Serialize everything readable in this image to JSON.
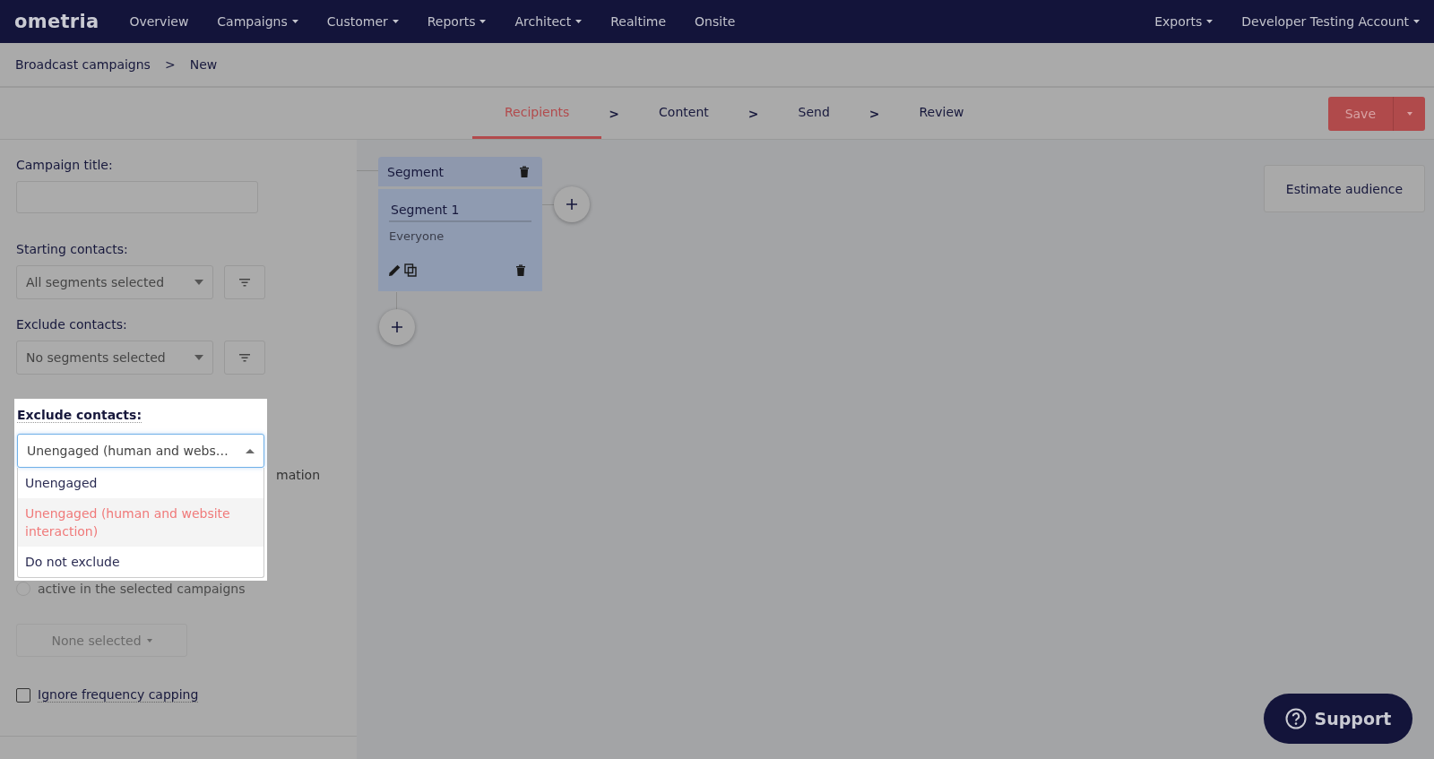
{
  "nav": {
    "logo": "ometria",
    "items": [
      {
        "label": "Overview",
        "dropdown": false
      },
      {
        "label": "Campaigns",
        "dropdown": true
      },
      {
        "label": "Customer",
        "dropdown": true
      },
      {
        "label": "Reports",
        "dropdown": true
      },
      {
        "label": "Architect",
        "dropdown": true
      },
      {
        "label": "Realtime",
        "dropdown": false
      },
      {
        "label": "Onsite",
        "dropdown": false
      }
    ],
    "right_items": [
      {
        "label": "Exports",
        "dropdown": true
      },
      {
        "label": "Developer Testing Account",
        "dropdown": true
      }
    ]
  },
  "breadcrumb": {
    "items": [
      "Broadcast campaigns",
      "New"
    ],
    "separator": ">"
  },
  "steps": [
    {
      "label": "Recipients",
      "selected": true
    },
    {
      "label": "Content",
      "selected": false
    },
    {
      "label": "Send",
      "selected": false
    },
    {
      "label": "Review",
      "selected": false
    }
  ],
  "step_separators": [
    ">",
    ">",
    ">"
  ],
  "save_button": {
    "label": "Save"
  },
  "form": {
    "campaign_title": {
      "label": "Campaign title:"
    },
    "starting_contacts": {
      "label": "Starting contacts:",
      "value": "All segments selected"
    },
    "exclude_contacts": {
      "label": "Exclude contacts:",
      "value": "No segments selected"
    },
    "behind_dropdown": {
      "text_fragment": "mation",
      "radio_option": {
        "label": "active in the selected campaigns",
        "checked": false
      }
    },
    "campaigns_select": {
      "label": "None selected",
      "disabled": true
    },
    "ignore_frequency_capping": {
      "label": "Ignore frequency capping",
      "checked": false
    }
  },
  "exclude_dropdown": {
    "label": "Exclude contacts:",
    "value": "Unengaged (human and webs…",
    "expanded": true,
    "options": [
      {
        "label": "Unengaged",
        "selected": false
      },
      {
        "label": "Unengaged (human and website interaction)",
        "selected": true
      },
      {
        "label": "Do not exclude",
        "selected": false
      }
    ]
  },
  "canvas": {
    "segment_node": {
      "title": "Segment",
      "name": "Segment 1",
      "description": "Everyone"
    },
    "estimate_button": {
      "label": "Estimate audience"
    }
  },
  "support_button": {
    "label": "Support"
  }
}
